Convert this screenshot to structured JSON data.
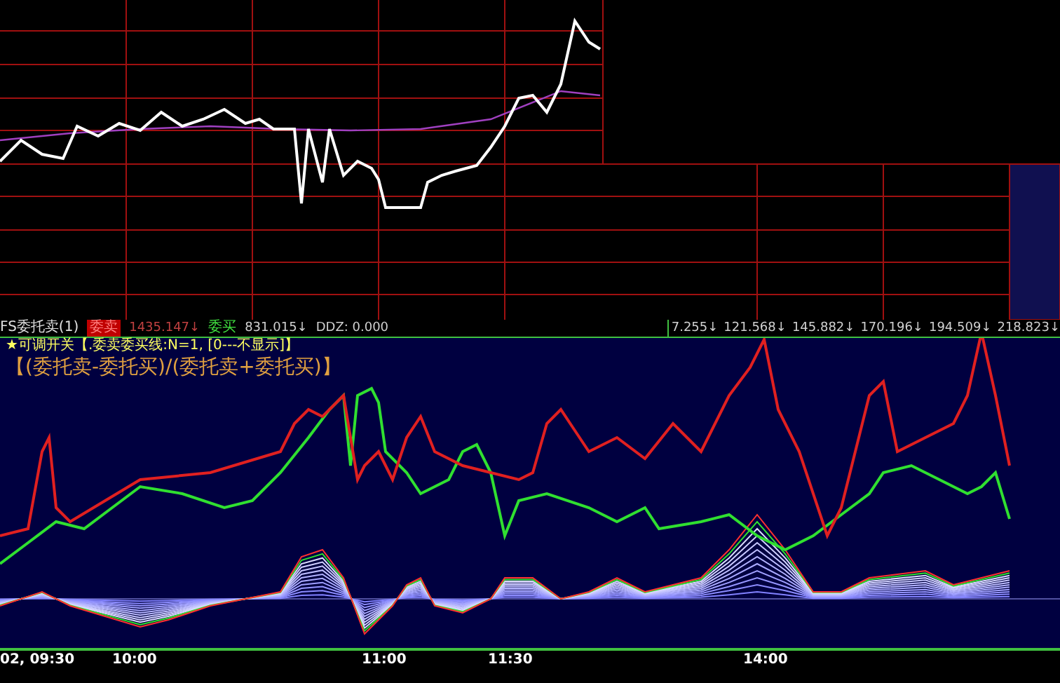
{
  "indicator_header": {
    "title": "FS委托卖(1)",
    "sell_label": "委卖",
    "sell_value": "1435.147↓",
    "buy_label": "委买",
    "buy_value": "831.015↓",
    "ddz": "DDZ: 0.000",
    "scale_values": [
      "7.255↓",
      "121.568↓",
      "145.882↓",
      "170.196↓",
      "194.509↓",
      "218.823↓"
    ]
  },
  "indicator_settings": "★可调开关【.委卖委买线:N=1, [0---不显示]】",
  "formula": "【(委托卖-委托买)/(委托卖+委托买)】",
  "time_axis": [
    "02, 09:30",
    "10:00",
    "11:00",
    "11:30",
    "14:00"
  ]
}
